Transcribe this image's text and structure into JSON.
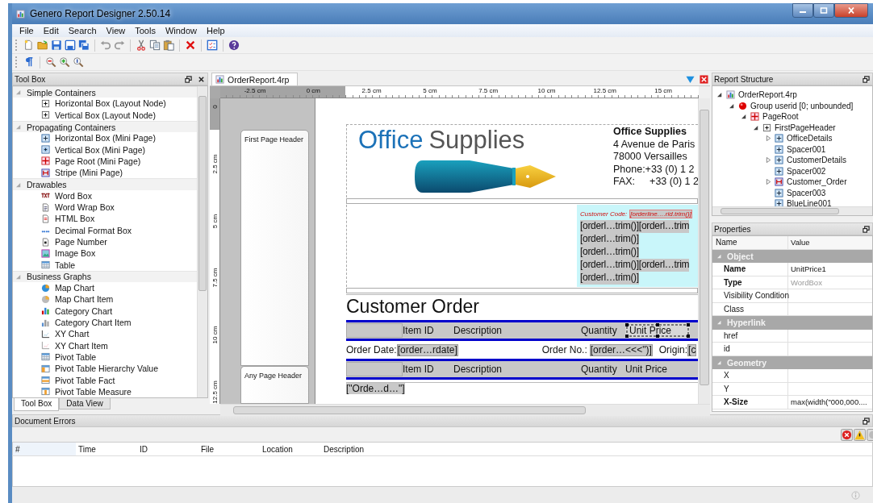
{
  "window": {
    "title": "Genero Report Designer 2.50.14"
  },
  "menu": [
    "File",
    "Edit",
    "Search",
    "View",
    "Tools",
    "Window",
    "Help"
  ],
  "toolbox": {
    "title": "Tool Box",
    "groups": [
      {
        "label": "Simple Containers",
        "expanded": true,
        "items": [
          {
            "label": "Horizontal Box (Layout Node)",
            "kind": "layout"
          },
          {
            "label": "Vertical Box (Layout Node)",
            "kind": "layout"
          }
        ]
      },
      {
        "label": "Propagating Containers",
        "expanded": true,
        "items": [
          {
            "label": "Horizontal Box (Mini Page)",
            "kind": "minih"
          },
          {
            "label": "Vertical Box (Mini Page)",
            "kind": "miniv"
          },
          {
            "label": "Page Root (Mini Page)",
            "kind": "pageroot"
          },
          {
            "label": "Stripe (Mini Page)",
            "kind": "stripe"
          }
        ]
      },
      {
        "label": "Drawables",
        "expanded": true,
        "items": [
          {
            "label": "Word Box",
            "kind": "text"
          },
          {
            "label": "Word Wrap Box",
            "kind": "doc"
          },
          {
            "label": "HTML Box",
            "kind": "html"
          },
          {
            "label": "Decimal Format Box",
            "kind": "decimal"
          },
          {
            "label": "Page Number",
            "kind": "pagenum"
          },
          {
            "label": "Image Box",
            "kind": "image"
          },
          {
            "label": "Table",
            "kind": "table"
          }
        ]
      },
      {
        "label": "Business Graphs",
        "expanded": true,
        "items": [
          {
            "label": "Map Chart",
            "kind": "globe"
          },
          {
            "label": "Map Chart Item",
            "kind": "globeitem"
          },
          {
            "label": "Category Chart",
            "kind": "bars"
          },
          {
            "label": "Category Chart Item",
            "kind": "barsitem"
          },
          {
            "label": "XY Chart",
            "kind": "xy"
          },
          {
            "label": "XY Chart Item",
            "kind": "xyitem"
          },
          {
            "label": "Pivot Table",
            "kind": "table"
          },
          {
            "label": "Pivot Table Hierarchy Value",
            "kind": "pivoth"
          },
          {
            "label": "Pivot Table Fact",
            "kind": "pivotf"
          },
          {
            "label": "Pivot Table Measure",
            "kind": "pivotm"
          }
        ]
      }
    ],
    "tabs": [
      {
        "label": "Tool Box",
        "selected": true
      },
      {
        "label": "Data View",
        "selected": false
      }
    ]
  },
  "editor": {
    "tab": {
      "label": "OrderReport.4rp",
      "selected": true
    },
    "ruler": {
      "horizontal": [
        "-2.5 cm",
        "0 cm",
        "2.5 cm",
        "5 cm",
        "7.5 cm",
        "10 cm",
        "12.5 cm",
        "15 cm"
      ],
      "vertical": [
        "0",
        "2.5 cm",
        "5 cm",
        "7.5 cm",
        "10 cm",
        "12.5 cm"
      ]
    },
    "sections": [
      "First Page Header",
      "Any Page Header"
    ],
    "report": {
      "logo": {
        "word_1": "Office",
        "word_2": "Supplies"
      },
      "address": [
        {
          "kind": "name",
          "label": "Office Supplies"
        },
        {
          "kind": "line",
          "label": "4 Avenue de Paris"
        },
        {
          "kind": "line",
          "label": "78000 Versailles"
        },
        {
          "kind": "line",
          "label": "Phone:+33 (0) 1 2"
        },
        {
          "kind": "fax",
          "label": "FAX:",
          "value": "+33 (0) 1 2"
        }
      ],
      "customer_code": {
        "label": "Customer Code:",
        "value": "[orderline….rid.trim()]"
      },
      "detail_rows": [
        [
          "[orderl…trim()]",
          "[orderl…trim"
        ],
        [
          "[orderl…trim()]"
        ],
        [
          "[orderl…trim()]"
        ],
        [
          "[orderl…trim()]",
          "[orderl…trim"
        ],
        [
          "[orderl…trim()]"
        ]
      ],
      "title": "Customer Order",
      "header_rows": [
        {
          "columns": [
            {
              "label": "Item ID",
              "selected": false
            },
            {
              "label": "Description",
              "selected": false
            },
            {
              "label": "Quantity",
              "selected": false
            },
            {
              "label": "Unit Price",
              "selected": true
            }
          ]
        },
        {
          "columns": [
            {
              "label": "Item ID",
              "selected": false
            },
            {
              "label": "Description",
              "selected": false
            },
            {
              "label": "Quantity",
              "selected": false
            },
            {
              "label": "Unit Price",
              "selected": false
            }
          ]
        }
      ],
      "order_line": [
        {
          "label": "Order Date:",
          "value": "[order…rdate]"
        },
        {
          "label": "Order No.:",
          "value": "[order…<<<\")]"
        },
        {
          "label": "Origin:",
          "value": "[c"
        }
      ],
      "last_row": "[\"Orde…d…\"]"
    }
  },
  "report_structure": {
    "title": "Report Structure",
    "tree": [
      {
        "label": "OrderReport.4rp",
        "kind": "file",
        "expandable": true,
        "expanded": true,
        "children": [
          {
            "label": "Group userid [0; unbounded]",
            "kind": "ball",
            "expandable": true,
            "expanded": true,
            "children": [
              {
                "label": "PageRoot",
                "kind": "pageroot",
                "expandable": true,
                "expanded": true,
                "children": [
                  {
                    "label": "FirstPageHeader",
                    "kind": "layout",
                    "expandable": true,
                    "expanded": true,
                    "children": [
                      {
                        "label": "OfficeDetails",
                        "kind": "minih",
                        "expandable": true,
                        "expanded": false
                      },
                      {
                        "label": "Spacer001",
                        "kind": "minih",
                        "expandable": false
                      },
                      {
                        "label": "CustomerDetails",
                        "kind": "minih",
                        "expandable": true,
                        "expanded": false
                      },
                      {
                        "label": "Spacer002",
                        "kind": "minih",
                        "expandable": false
                      },
                      {
                        "label": "Customer_Order",
                        "kind": "stripe",
                        "expandable": true,
                        "expanded": false
                      },
                      {
                        "label": "Spacer003",
                        "kind": "minih",
                        "expandable": false
                      },
                      {
                        "label": "BlueLine001",
                        "kind": "minih",
                        "expandable": false
                      }
                    ]
                  }
                ]
              }
            ]
          }
        ]
      }
    ]
  },
  "properties": {
    "title": "Properties",
    "columns": [
      "Name",
      "Value"
    ],
    "groups": [
      {
        "label": "Object",
        "expanded": true,
        "rows": [
          {
            "name": "Name",
            "value": "UnitPrice1",
            "bold": true,
            "readonly": false
          },
          {
            "name": "Type",
            "value": "WordBox",
            "bold": true,
            "readonly": true
          },
          {
            "name": "Visibility Condition",
            "bold": false,
            "readonly": false
          },
          {
            "name": "Class",
            "bold": false,
            "readonly": false
          }
        ]
      },
      {
        "label": "Hyperlink",
        "expanded": true,
        "rows": [
          {
            "name": "href",
            "bold": false,
            "readonly": false
          },
          {
            "name": "id",
            "bold": false,
            "readonly": false
          }
        ]
      },
      {
        "label": "Geometry",
        "expanded": true,
        "rows": [
          {
            "name": "X",
            "bold": false,
            "readonly": false
          },
          {
            "name": "Y",
            "bold": false,
            "readonly": false
          },
          {
            "name": "X-Size",
            "value": "max(width(\"000,000....",
            "bold": true,
            "readonly": false
          }
        ]
      }
    ]
  },
  "document_errors": {
    "title": "Document Errors",
    "columns": [
      "#",
      "Time",
      "ID",
      "File",
      "Location",
      "Description"
    ]
  }
}
